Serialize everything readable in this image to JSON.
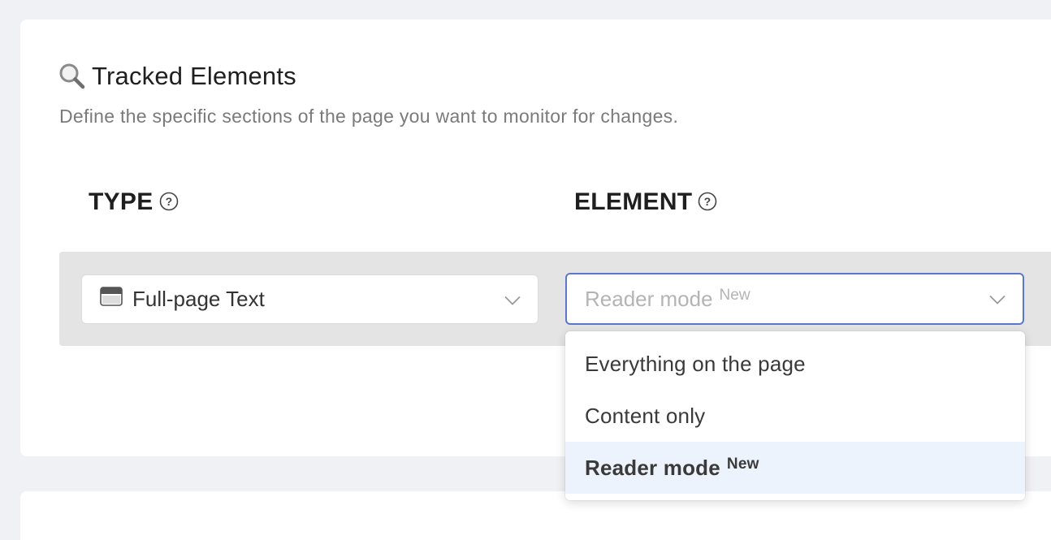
{
  "section": {
    "title": "Tracked Elements",
    "description": "Define the specific sections of the page you want to monitor for changes.",
    "icon": "search-icon"
  },
  "columns": {
    "type_label": "TYPE",
    "element_label": "ELEMENT",
    "help_icon": "question-circle-icon"
  },
  "type_select": {
    "value": "Full-page Text",
    "icon": "browser-window-icon"
  },
  "element_select": {
    "placeholder": "Reader mode",
    "placeholder_badge": "New"
  },
  "dropdown": {
    "options": [
      {
        "label": "Everything on the page",
        "badge": ""
      },
      {
        "label": "Content only",
        "badge": ""
      },
      {
        "label": "Reader mode",
        "badge": "New",
        "highlighted": true
      }
    ]
  },
  "colors": {
    "page_bg": "#f0f1f5",
    "focus_border": "#5b77c9",
    "highlight_bg": "#ecf3fc"
  }
}
